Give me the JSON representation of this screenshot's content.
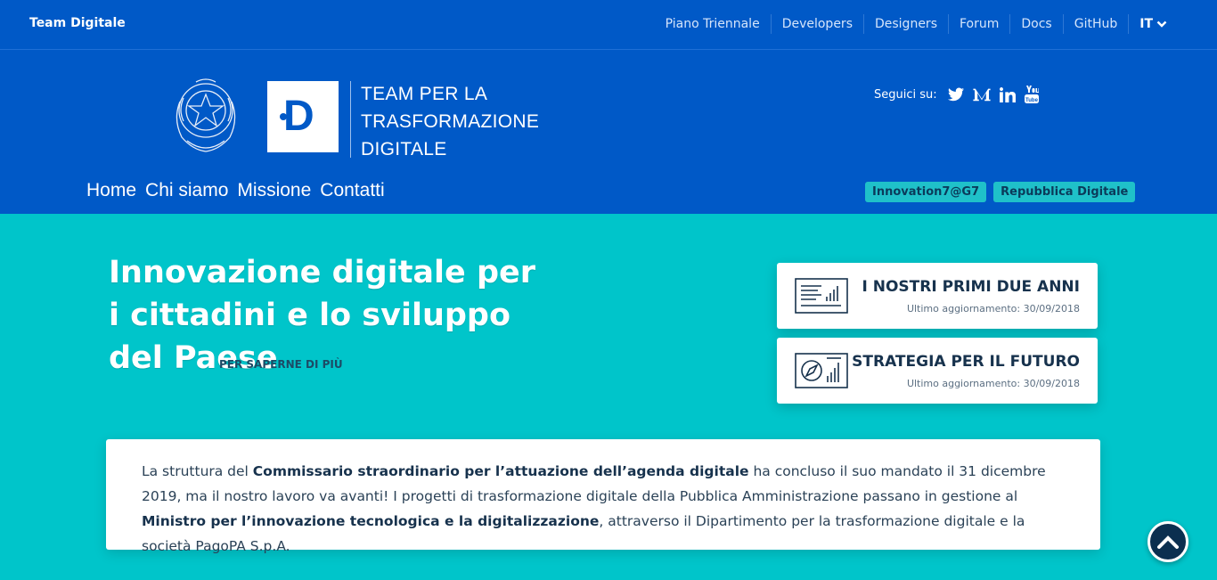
{
  "topbar": {
    "brand": "Team Digitale",
    "links": [
      "Piano Triennale",
      "Developers",
      "Designers",
      "Forum",
      "Docs",
      "GitHub"
    ],
    "language": "IT"
  },
  "header": {
    "logo_letter": "D",
    "title_lines": [
      "TEAM PER LA",
      "TRASFORMAZIONE",
      "DIGITALE"
    ],
    "social_label": "Seguici su:",
    "social_icons": [
      "twitter-icon",
      "medium-icon",
      "linkedin-icon",
      "youtube-icon"
    ],
    "nav": [
      "Home",
      "Chi siamo",
      "Missione",
      "Contatti"
    ],
    "badges": [
      "Innovation7@G7",
      "Repubblica Digitale"
    ]
  },
  "hero": {
    "title": "Innovazione digitale per i cittadini e lo sviluppo del Paese",
    "more_link": "PER SAPERNE DI PIÙ",
    "cards": [
      {
        "title": "I NOSTRI PRIMI DUE ANNI",
        "updated": "Ultimo aggiornamento: 30/09/2018",
        "icon": "report-icon"
      },
      {
        "title": "STRATEGIA PER IL FUTURO",
        "updated": "Ultimo aggiornamento: 30/09/2018",
        "icon": "compass-icon"
      }
    ]
  },
  "notice": {
    "p1": "La struttura del ",
    "b1": "Commissario straordinario per l’attuazione dell’agenda digitale",
    "p2": " ha concluso il suo mandato il 31 dicembre 2019, ma il nostro lavoro va avanti! I progetti di trasformazione digitale della Pubblica Amministrazione passano in gestione al ",
    "b2": "Ministro per l’innovazione tecnologica e la digitalizzazione",
    "p3": ", attraverso il Dipartimento per la trasformazione digitale e la società PagoPA S.p.A."
  },
  "colors": {
    "primary_blue": "#0059c7",
    "hero_teal": "#00c5ca",
    "badge_teal": "#1fc1c9",
    "dark_navy": "#17324d"
  }
}
